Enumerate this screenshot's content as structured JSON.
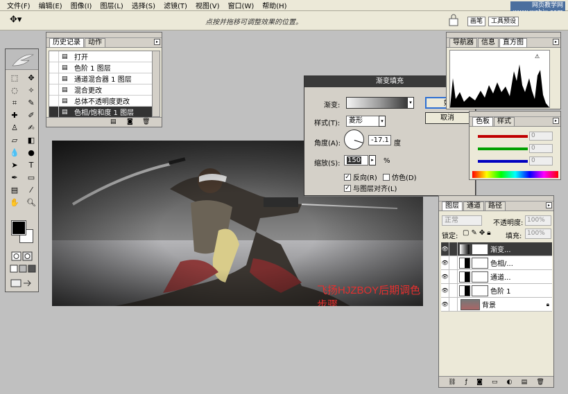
{
  "menu": [
    "文件(F)",
    "编辑(E)",
    "图像(I)",
    "图层(L)",
    "选择(S)",
    "滤镜(T)",
    "视图(V)",
    "窗口(W)",
    "帮助(H)"
  ],
  "watermark": {
    "line1": "网页教学网",
    "line2": "www.webjx.com"
  },
  "options": {
    "hint": "点按并拖移可调整效果的位置。",
    "brush_tab": "画笔",
    "tools_tab": "工具预设"
  },
  "history": {
    "tabs": [
      "历史记录",
      "动作"
    ],
    "items": [
      {
        "label": "打开",
        "selected": false
      },
      {
        "label": "色阶 1 图层",
        "selected": false
      },
      {
        "label": "通道混合器 1 图层",
        "selected": false
      },
      {
        "label": "混合更改",
        "selected": false
      },
      {
        "label": "总体不透明度更改",
        "selected": false
      },
      {
        "label": "色相/饱和度 1 图层",
        "selected": true
      }
    ]
  },
  "canvas": {
    "credit": "飞扬HJZBOY后期调色步骤"
  },
  "dialog": {
    "title": "渐变填充",
    "gradient_label": "渐变:",
    "style_label": "样式(T):",
    "style_value": "菱形",
    "angle_label": "角度(A):",
    "angle_value": "-17.1",
    "angle_unit": "度",
    "scale_label": "缩放(S):",
    "scale_value": "150",
    "scale_unit": "%",
    "reverse_label": "反向(R)",
    "reverse_checked": true,
    "dither_label": "仿色(D)",
    "dither_checked": false,
    "align_label": "与图层对齐(L)",
    "align_checked": true,
    "ok_label": "好",
    "cancel_label": "取消"
  },
  "navigator": {
    "tabs": [
      "导航器",
      "信息",
      "直方图"
    ]
  },
  "color": {
    "tabs": [
      "色板",
      "样式"
    ],
    "values": [
      "0",
      "0",
      "0"
    ],
    "colors": {
      "r": "#c00000",
      "g": "#00a000",
      "b": "#0000c0"
    }
  },
  "layers": {
    "tabs": [
      "图层",
      "通道",
      "路径"
    ],
    "blend_mode": "正常",
    "opacity_label": "不透明度:",
    "opacity_value": "100%",
    "lock_label": "锁定:",
    "fill_label": "填充:",
    "fill_value": "100%",
    "items": [
      {
        "name": "渐变...",
        "selected": true
      },
      {
        "name": "色相/...",
        "selected": false
      },
      {
        "name": "通道...",
        "selected": false
      },
      {
        "name": "色阶 1",
        "selected": false
      },
      {
        "name": "背景",
        "selected": false
      }
    ]
  }
}
